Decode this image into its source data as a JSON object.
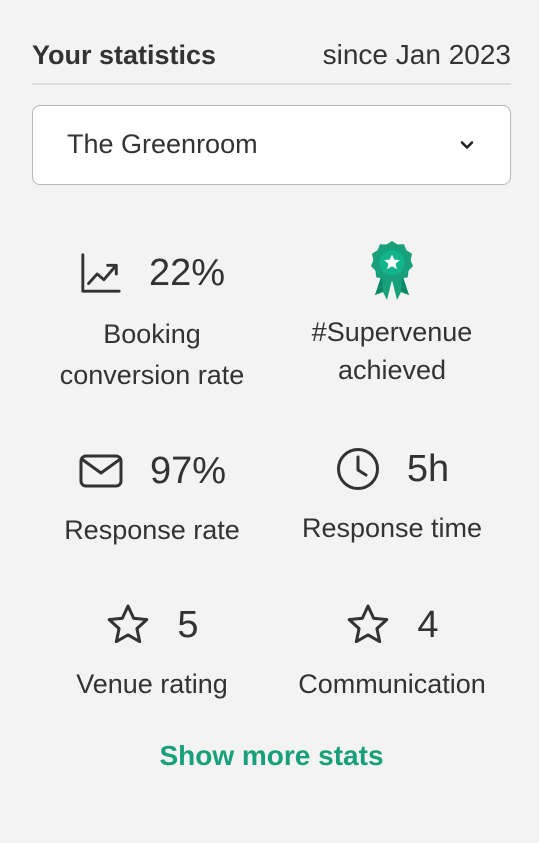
{
  "header": {
    "title": "Your statistics",
    "since": "since Jan 2023"
  },
  "venue_select": {
    "selected": "The Greenroom"
  },
  "stats": {
    "booking_conversion": {
      "value": "22%",
      "label_line1": "Booking",
      "label_line2": "conversion rate",
      "icon": "trending-up-chart-icon"
    },
    "supervenue": {
      "label_line1": "#Supervenue",
      "label_line2": "achieved",
      "icon": "award-ribbon-icon"
    },
    "response_rate": {
      "value": "97%",
      "label": "Response rate",
      "icon": "mail-icon"
    },
    "response_time": {
      "value": "5h",
      "label": "Response time",
      "icon": "clock-icon"
    },
    "venue_rating": {
      "value": "5",
      "label": "Venue rating",
      "icon": "star-icon"
    },
    "communication": {
      "value": "4",
      "label": "Communication",
      "icon": "star-icon"
    }
  },
  "show_more": "Show more stats",
  "colors": {
    "accent": "#17a07a",
    "background": "#f3f3f3",
    "text": "#333333"
  }
}
